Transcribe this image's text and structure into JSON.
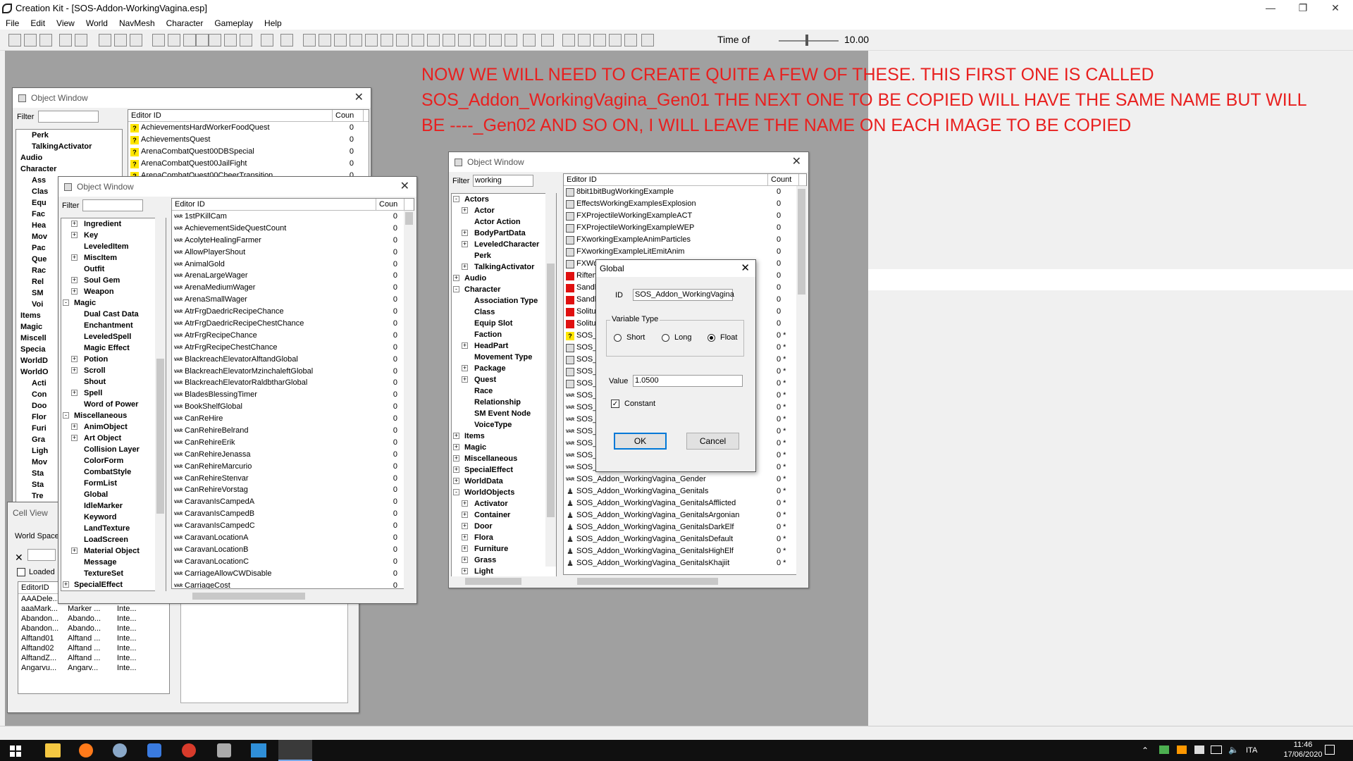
{
  "app": {
    "title": "Creation Kit - [SOS-Addon-WorkingVagina.esp]",
    "menu": [
      "File",
      "Edit",
      "View",
      "World",
      "NavMesh",
      "Character",
      "Gameplay",
      "Help"
    ],
    "time_label": "Time of",
    "time_value": "10.00",
    "window_buttons": {
      "minimize": "—",
      "restore": "❐",
      "close": "✕"
    }
  },
  "annotation": {
    "line1": "NOW WE WILL NEED TO CREATE QUITE A FEW OF THESE.  THIS FIRST ONE IS CALLED",
    "line2": "SOS_Addon_WorkingVagina_Gen01   THE NEXT ONE TO BE COPIED WILL HAVE THE SAME NAME BUT WILL",
    "line3": "BE   ----_Gen02   AND SO ON, I WILL LEAVE THE NAME ON EACH IMAGE TO BE COPIED",
    "color": "#e8201f"
  },
  "objwin1": {
    "title": "Object Window",
    "filter_label": "Filter",
    "filter_value": "",
    "col_editor": "Editor ID",
    "col_count": "Coun",
    "tree": [
      "Perk",
      "TalkingActivator",
      "Audio",
      "Character",
      "Ass",
      "Clas",
      "Equ",
      "Fac",
      "Hea",
      "Mov",
      "Pac",
      "Que",
      "Rac",
      "Rel",
      "SM",
      "Voi",
      "Items",
      "Magic",
      "Miscell",
      "Specia",
      "WorldD",
      "WorldO",
      "Acti",
      "Con",
      "Doo",
      "Flor",
      "Furi",
      "Gra",
      "Ligh",
      "Mov",
      "Sta",
      "Sta",
      "Tre"
    ],
    "rows": [
      {
        "name": "AchievementsHardWorkerFoodQuest",
        "count": "0"
      },
      {
        "name": "AchievementsQuest",
        "count": "0"
      },
      {
        "name": "ArenaCombatQuest00DBSpecial",
        "count": "0"
      },
      {
        "name": "ArenaCombatQuest00JailFight",
        "count": "0"
      },
      {
        "name": "ArenaCombatQuest00CheerTransition",
        "count": "0"
      }
    ]
  },
  "cellview": {
    "title": "Cell View",
    "worldspace_label": "World Space",
    "loaded_label": "Loaded",
    "col_editor": "EditorID",
    "rows": [
      [
        "AAADele...",
        "",
        ""
      ],
      [
        "aaaMark...",
        "Marker ...",
        "Inte..."
      ],
      [
        "Abandon...",
        "Abando...",
        "Inte..."
      ],
      [
        "Abandon...",
        "Abando...",
        "Inte..."
      ],
      [
        "Alftand01",
        "Alftand ...",
        "Inte..."
      ],
      [
        "Alftand02",
        "Alftand ...",
        "Inte..."
      ],
      [
        "AlftandZ...",
        "Alftand ...",
        "Inte..."
      ],
      [
        "Angarvu...",
        "Angarv...",
        "Inte..."
      ]
    ]
  },
  "objwin2": {
    "title": "Object Window",
    "filter_label": "Filter",
    "filter_value": "",
    "col_editor": "Editor ID",
    "col_count": "Coun",
    "tree": [
      {
        "t": "Ingredient",
        "exp": "+",
        "lvl": 1
      },
      {
        "t": "Key",
        "exp": "+",
        "lvl": 1
      },
      {
        "t": "LeveledItem",
        "exp": "",
        "lvl": 1
      },
      {
        "t": "MiscItem",
        "exp": "+",
        "lvl": 1
      },
      {
        "t": "Outfit",
        "exp": "",
        "lvl": 1
      },
      {
        "t": "Soul Gem",
        "exp": "+",
        "lvl": 1
      },
      {
        "t": "Weapon",
        "exp": "+",
        "lvl": 1
      },
      {
        "t": "Magic",
        "exp": "-",
        "lvl": 0
      },
      {
        "t": "Dual Cast Data",
        "exp": "",
        "lvl": 1
      },
      {
        "t": "Enchantment",
        "exp": "",
        "lvl": 1
      },
      {
        "t": "LeveledSpell",
        "exp": "",
        "lvl": 1
      },
      {
        "t": "Magic Effect",
        "exp": "",
        "lvl": 1
      },
      {
        "t": "Potion",
        "exp": "+",
        "lvl": 1
      },
      {
        "t": "Scroll",
        "exp": "+",
        "lvl": 1
      },
      {
        "t": "Shout",
        "exp": "",
        "lvl": 1
      },
      {
        "t": "Spell",
        "exp": "+",
        "lvl": 1
      },
      {
        "t": "Word of Power",
        "exp": "",
        "lvl": 1
      },
      {
        "t": "Miscellaneous",
        "exp": "-",
        "lvl": 0
      },
      {
        "t": "AnimObject",
        "exp": "+",
        "lvl": 1
      },
      {
        "t": "Art Object",
        "exp": "+",
        "lvl": 1
      },
      {
        "t": "Collision Layer",
        "exp": "",
        "lvl": 1
      },
      {
        "t": "ColorForm",
        "exp": "",
        "lvl": 1
      },
      {
        "t": "CombatStyle",
        "exp": "",
        "lvl": 1
      },
      {
        "t": "FormList",
        "exp": "",
        "lvl": 1
      },
      {
        "t": "Global",
        "exp": "",
        "lvl": 1
      },
      {
        "t": "IdleMarker",
        "exp": "",
        "lvl": 1
      },
      {
        "t": "Keyword",
        "exp": "",
        "lvl": 1
      },
      {
        "t": "LandTexture",
        "exp": "",
        "lvl": 1
      },
      {
        "t": "LoadScreen",
        "exp": "",
        "lvl": 1
      },
      {
        "t": "Material Object",
        "exp": "+",
        "lvl": 1
      },
      {
        "t": "Message",
        "exp": "",
        "lvl": 1
      },
      {
        "t": "TextureSet",
        "exp": "",
        "lvl": 1
      },
      {
        "t": "SpecialEffect",
        "exp": "+",
        "lvl": 0
      }
    ],
    "rows": [
      "1stPKillCam",
      "AchievementSideQuestCount",
      "AcolyteHealingFarmer",
      "AllowPlayerShout",
      "AnimalGold",
      "ArenaLargeWager",
      "ArenaMediumWager",
      "ArenaSmallWager",
      "AtrFrgDaedricRecipeChance",
      "AtrFrgDaedricRecipeChestChance",
      "AtrFrgRecipeChance",
      "AtrFrgRecipeChestChance",
      "BlackreachElevatorAlftandGlobal",
      "BlackreachElevatorMzinchaleftGlobal",
      "BlackreachElevatorRaldbtharGlobal",
      "BladesBlessingTimer",
      "BookShelfGlobal",
      "CanReHire",
      "CanRehireBelrand",
      "CanRehireErik",
      "CanRehireJenassa",
      "CanRehireMarcurio",
      "CanRehireStenvar",
      "CanRehireVorstag",
      "CaravanIsCampedA",
      "CaravanIsCampedB",
      "CaravanIsCampedC",
      "CaravanLocationA",
      "CaravanLocationB",
      "CaravanLocationC",
      "CarriageAllowCWDisable",
      "CarriageCost"
    ],
    "row_count": "0",
    "var_tag": "VAR"
  },
  "objwin3": {
    "title": "Object Window",
    "filter_label": "Filter",
    "filter_value": "working",
    "col_editor": "Editor ID",
    "col_count": "Count",
    "tree": [
      {
        "t": "Actors",
        "exp": "-",
        "lvl": 0
      },
      {
        "t": "Actor",
        "exp": "+",
        "lvl": 1
      },
      {
        "t": "Actor Action",
        "exp": "",
        "lvl": 1
      },
      {
        "t": "BodyPartData",
        "exp": "+",
        "lvl": 1
      },
      {
        "t": "LeveledCharacter",
        "exp": "+",
        "lvl": 1
      },
      {
        "t": "Perk",
        "exp": "",
        "lvl": 1
      },
      {
        "t": "TalkingActivator",
        "exp": "+",
        "lvl": 1
      },
      {
        "t": "Audio",
        "exp": "+",
        "lvl": 0
      },
      {
        "t": "Character",
        "exp": "-",
        "lvl": 0
      },
      {
        "t": "Association Type",
        "exp": "",
        "lvl": 1
      },
      {
        "t": "Class",
        "exp": "",
        "lvl": 1
      },
      {
        "t": "Equip Slot",
        "exp": "",
        "lvl": 1
      },
      {
        "t": "Faction",
        "exp": "",
        "lvl": 1
      },
      {
        "t": "HeadPart",
        "exp": "+",
        "lvl": 1
      },
      {
        "t": "Movement Type",
        "exp": "",
        "lvl": 1
      },
      {
        "t": "Package",
        "exp": "+",
        "lvl": 1
      },
      {
        "t": "Quest",
        "exp": "+",
        "lvl": 1
      },
      {
        "t": "Race",
        "exp": "",
        "lvl": 1
      },
      {
        "t": "Relationship",
        "exp": "",
        "lvl": 1
      },
      {
        "t": "SM Event Node",
        "exp": "",
        "lvl": 1
      },
      {
        "t": "VoiceType",
        "exp": "",
        "lvl": 1
      },
      {
        "t": "Items",
        "exp": "+",
        "lvl": 0
      },
      {
        "t": "Magic",
        "exp": "+",
        "lvl": 0
      },
      {
        "t": "Miscellaneous",
        "exp": "+",
        "lvl": 0
      },
      {
        "t": "SpecialEffect",
        "exp": "+",
        "lvl": 0
      },
      {
        "t": "WorldData",
        "exp": "+",
        "lvl": 0
      },
      {
        "t": "WorldObjects",
        "exp": "-",
        "lvl": 0
      },
      {
        "t": "Activator",
        "exp": "+",
        "lvl": 1
      },
      {
        "t": "Container",
        "exp": "+",
        "lvl": 1
      },
      {
        "t": "Door",
        "exp": "+",
        "lvl": 1
      },
      {
        "t": "Flora",
        "exp": "+",
        "lvl": 1
      },
      {
        "t": "Furniture",
        "exp": "+",
        "lvl": 1
      },
      {
        "t": "Grass",
        "exp": "+",
        "lvl": 1
      },
      {
        "t": "Light",
        "exp": "+",
        "lvl": 1
      }
    ],
    "rows": [
      {
        "icon": "gen",
        "name": "8bit1bitBugWorkingExample",
        "count": "0"
      },
      {
        "icon": "gen",
        "name": "EffectsWorkingExamplesExplosion",
        "count": "0"
      },
      {
        "icon": "gen",
        "name": "FXProjectileWorkingExampleACT",
        "count": "0"
      },
      {
        "icon": "gen",
        "name": "FXProjectileWorkingExampleWEP",
        "count": "0"
      },
      {
        "icon": "gen",
        "name": "FXworkingExampleAnimParticles",
        "count": "0"
      },
      {
        "icon": "gen",
        "name": "FXworkingExampleLitEmitAnim",
        "count": "0"
      },
      {
        "icon": "gen",
        "name": "FXWo",
        "count": "0"
      },
      {
        "icon": "red",
        "name": "Riften",
        "count": "0"
      },
      {
        "icon": "red",
        "name": "Sandb",
        "count": "0"
      },
      {
        "icon": "red",
        "name": "Sandb",
        "count": "0"
      },
      {
        "icon": "red",
        "name": "Solitu",
        "count": "0"
      },
      {
        "icon": "red",
        "name": "Solitu",
        "count": "0"
      },
      {
        "icon": "q",
        "name": "SOS_",
        "count": "0 *"
      },
      {
        "icon": "gen",
        "name": "SOS_",
        "count": "0 *"
      },
      {
        "icon": "gen",
        "name": "SOS_",
        "count": "0 *"
      },
      {
        "icon": "gen",
        "name": "SOS_",
        "count": "0 *"
      },
      {
        "icon": "gen",
        "name": "SOS_",
        "count": "0 *"
      },
      {
        "icon": "var",
        "name": "SOS_",
        "count": "0 *"
      },
      {
        "icon": "var",
        "name": "SOS_",
        "count": "0 *"
      },
      {
        "icon": "var",
        "name": "SOS_",
        "count": "0 *"
      },
      {
        "icon": "var",
        "name": "SOS_",
        "count": "0 *"
      },
      {
        "icon": "var",
        "name": "SOS_",
        "count": "0 *"
      },
      {
        "icon": "var",
        "name": "SOS_",
        "count": "0 *"
      },
      {
        "icon": "var",
        "name": "SOS_",
        "count": "0 *"
      },
      {
        "icon": "var",
        "name": "SOS_Addon_WorkingVagina_Gender",
        "count": "0 *"
      },
      {
        "icon": "fig",
        "name": "SOS_Addon_WorkingVagina_Genitals",
        "count": "0 *"
      },
      {
        "icon": "fig",
        "name": "SOS_Addon_WorkingVagina_GenitalsAfflicted",
        "count": "0 *"
      },
      {
        "icon": "fig",
        "name": "SOS_Addon_WorkingVagina_GenitalsArgonian",
        "count": "0 *"
      },
      {
        "icon": "fig",
        "name": "SOS_Addon_WorkingVagina_GenitalsDarkElf",
        "count": "0 *"
      },
      {
        "icon": "fig",
        "name": "SOS_Addon_WorkingVagina_GenitalsDefault",
        "count": "0 *"
      },
      {
        "icon": "fig",
        "name": "SOS_Addon_WorkingVagina_GenitalsHighElf",
        "count": "0 *"
      },
      {
        "icon": "fig",
        "name": "SOS_Addon_WorkingVagina_GenitalsKhajiit",
        "count": "0 *"
      }
    ],
    "var_tag": "VAR"
  },
  "dialog": {
    "title": "Global",
    "id_label": "ID",
    "id_value": "SOS_Addon_WorkingVagina",
    "vartype_label": "Variable Type",
    "opt_short": "Short",
    "opt_long": "Long",
    "opt_float": "Float",
    "selected": "Float",
    "value_label": "Value",
    "value": "1.0500",
    "constant_label": "Constant",
    "constant_checked": true,
    "ok": "OK",
    "cancel": "Cancel"
  },
  "taskbar": {
    "lang": "ITA",
    "time": "11:46",
    "date": "17/06/2020"
  }
}
